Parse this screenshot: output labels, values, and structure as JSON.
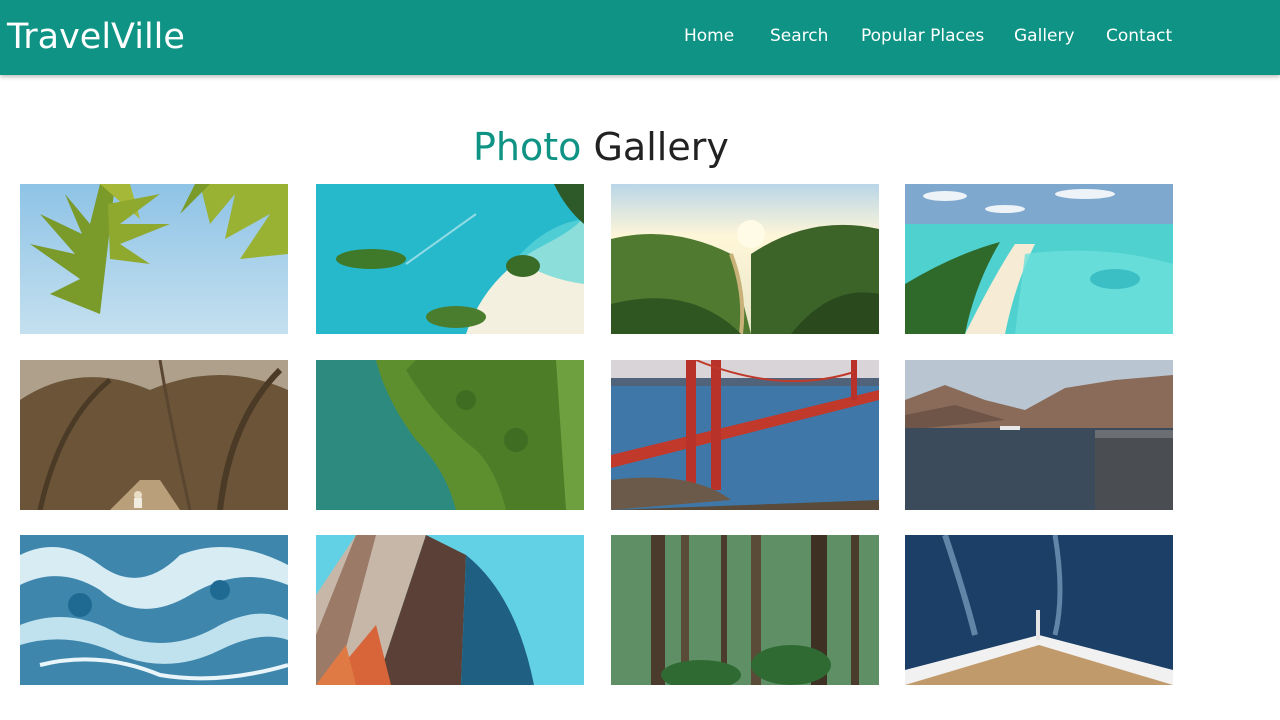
{
  "brand": "TravelVille",
  "nav": {
    "items": [
      "Home",
      "Search",
      "Popular Places",
      "Gallery",
      "Contact"
    ]
  },
  "gallery": {
    "title_accent": "Photo",
    "title_rest": " Gallery"
  },
  "colors": {
    "brand": "#0e9384",
    "nav_text": "#ffffff",
    "title_text": "#222222"
  }
}
